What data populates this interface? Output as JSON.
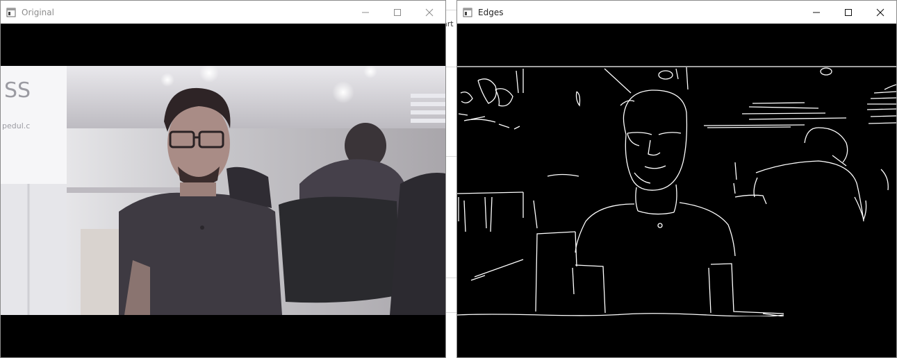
{
  "background_app": {
    "snippet": "art"
  },
  "windows": {
    "original": {
      "title": "Original",
      "icon": "app-window-icon",
      "controls": [
        "minimize-icon",
        "maximize-icon",
        "close-icon"
      ]
    },
    "edges": {
      "title": "Edges",
      "icon": "app-window-icon",
      "controls": [
        "minimize-icon",
        "maximize-icon",
        "close-icon"
      ]
    }
  },
  "colors": {
    "titlebar_bg": "#ffffff",
    "client_bg": "#000000",
    "edge_line": "#ffffff",
    "inactive_title": "#8c8c8c",
    "active_title": "#222222"
  }
}
